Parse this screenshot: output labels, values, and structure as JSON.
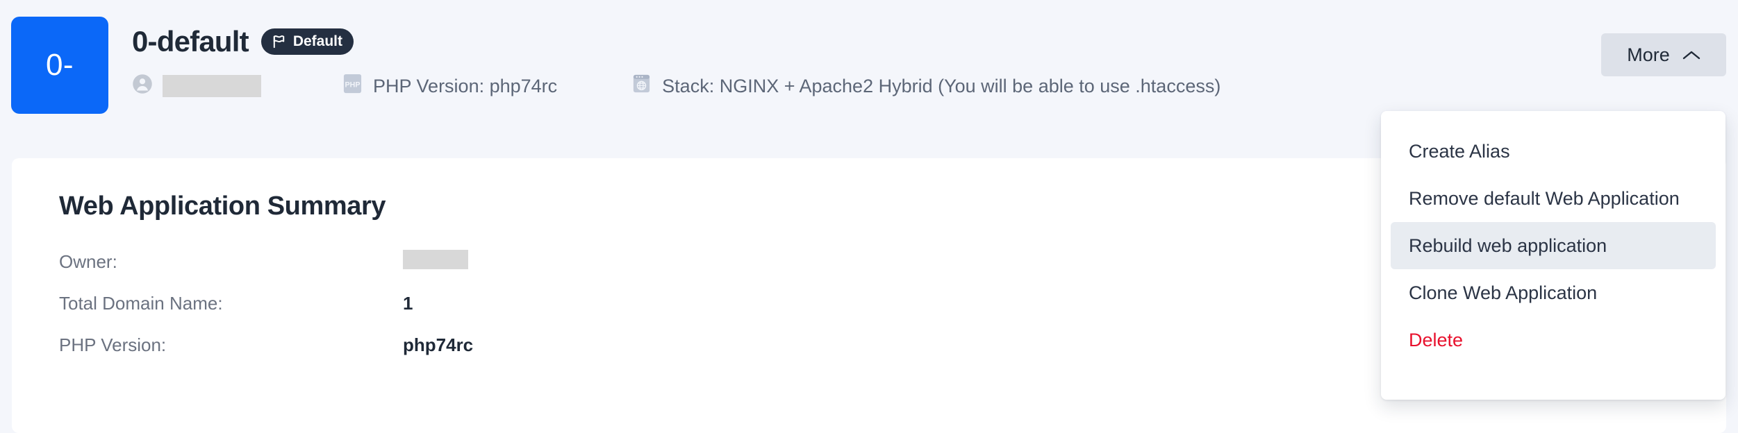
{
  "header": {
    "logo_text": "0-",
    "logo_color": "#0b68f8",
    "title": "0-default",
    "badge": {
      "label": "Default",
      "icon": "flag-icon",
      "background": "#242f41"
    },
    "meta": [
      {
        "icon": "user-icon",
        "label": "",
        "redacted": true
      },
      {
        "icon": "php-icon",
        "label": "PHP Version: php74rc",
        "redacted": false
      },
      {
        "icon": "globe-window-icon",
        "label": "Stack: NGINX + Apache2 Hybrid (You will be able to use .htaccess)",
        "redacted": false
      }
    ],
    "more_button": {
      "label": "More",
      "icon": "chevron-up-icon",
      "background": "#dde1e9",
      "expanded": true
    }
  },
  "dropdown": {
    "visible": true,
    "items": [
      {
        "label": "Create Alias",
        "state": "normal"
      },
      {
        "label": "Remove default Web Application",
        "state": "normal"
      },
      {
        "label": "Rebuild web application",
        "state": "hovered"
      },
      {
        "label": "Clone Web Application",
        "state": "normal"
      },
      {
        "label": "Delete",
        "state": "danger"
      }
    ],
    "hover_background": "#e8ecf1",
    "danger_color": "#e8112d"
  },
  "main": {
    "card_title": "Web Application Summary",
    "summary": [
      {
        "label": "Owner:",
        "value": "",
        "redacted": true
      },
      {
        "label": "Total Domain Name:",
        "value": "1",
        "redacted": false
      },
      {
        "label": "PHP Version:",
        "value": "php74rc",
        "redacted": false
      }
    ]
  }
}
